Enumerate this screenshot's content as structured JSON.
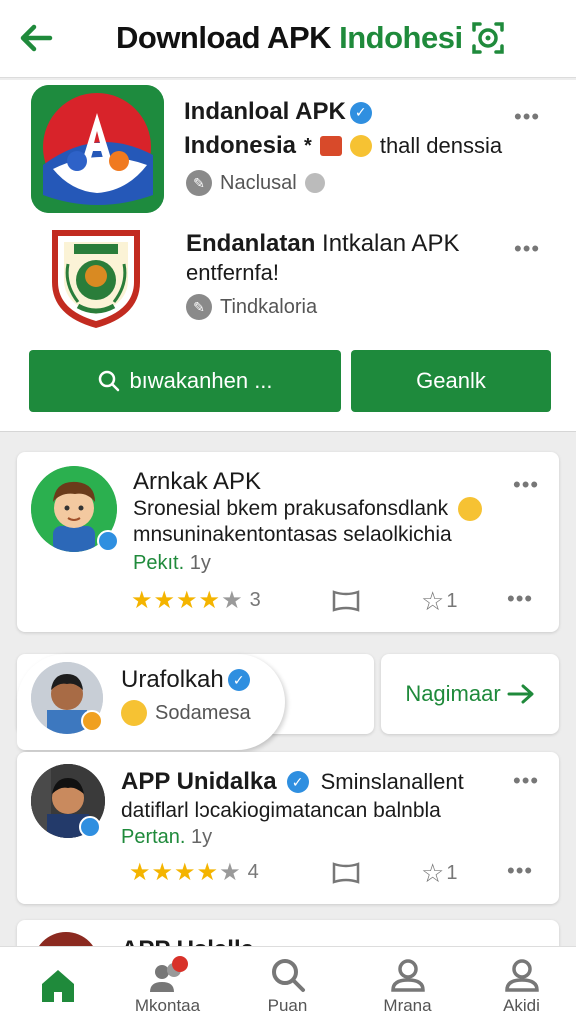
{
  "header": {
    "title_dark": "Download APK ",
    "title_green": "Indohesi",
    "accent": "#1f8a3b"
  },
  "apps": [
    {
      "name": "Indanloal APK",
      "name_line2": "Indonesia",
      "extra": "thall denssia",
      "meta": "Naclusal",
      "verified": true
    },
    {
      "name": "Endanlatan",
      "name_rest": " Intkalan APK",
      "name_line2": "entfernfa!",
      "meta": "Tindkaloria"
    }
  ],
  "buttons": {
    "search": "bıwakanhen ...",
    "generate": "Geanlk"
  },
  "posts": [
    {
      "title": "Arnkak APK",
      "body_line1": "Sronesial bkem prakusafonsdlank",
      "body_line2": "mnsuninakentontasas selaolkichia",
      "time_label": "Pekıt.",
      "time_ago": "1y",
      "rating_count": "3",
      "fav_count": "1",
      "rating": 4.5
    },
    {
      "title": "APP Unidalka",
      "title_rest": "Sminslanallent",
      "body_line1": "datiflarl lɔcakiogimatancan balnbla",
      "time_label": "Pertan.",
      "time_ago": "1y",
      "rating_count": "4",
      "fav_count": "1",
      "rating": 4.5
    }
  ],
  "pill": {
    "name": "Urafolkah",
    "sub": "Sodamesa"
  },
  "nav_card": {
    "label": "Nagimaar"
  },
  "partial_card": {
    "title": "APP Uslalla"
  },
  "bottom_nav": [
    {
      "label": "",
      "icon": "home-icon"
    },
    {
      "label": "Mkontaa",
      "icon": "people-icon"
    },
    {
      "label": "Puan",
      "icon": "search-icon"
    },
    {
      "label": "Mrana",
      "icon": "person-icon"
    },
    {
      "label": "Akidi",
      "icon": "person-icon"
    }
  ]
}
